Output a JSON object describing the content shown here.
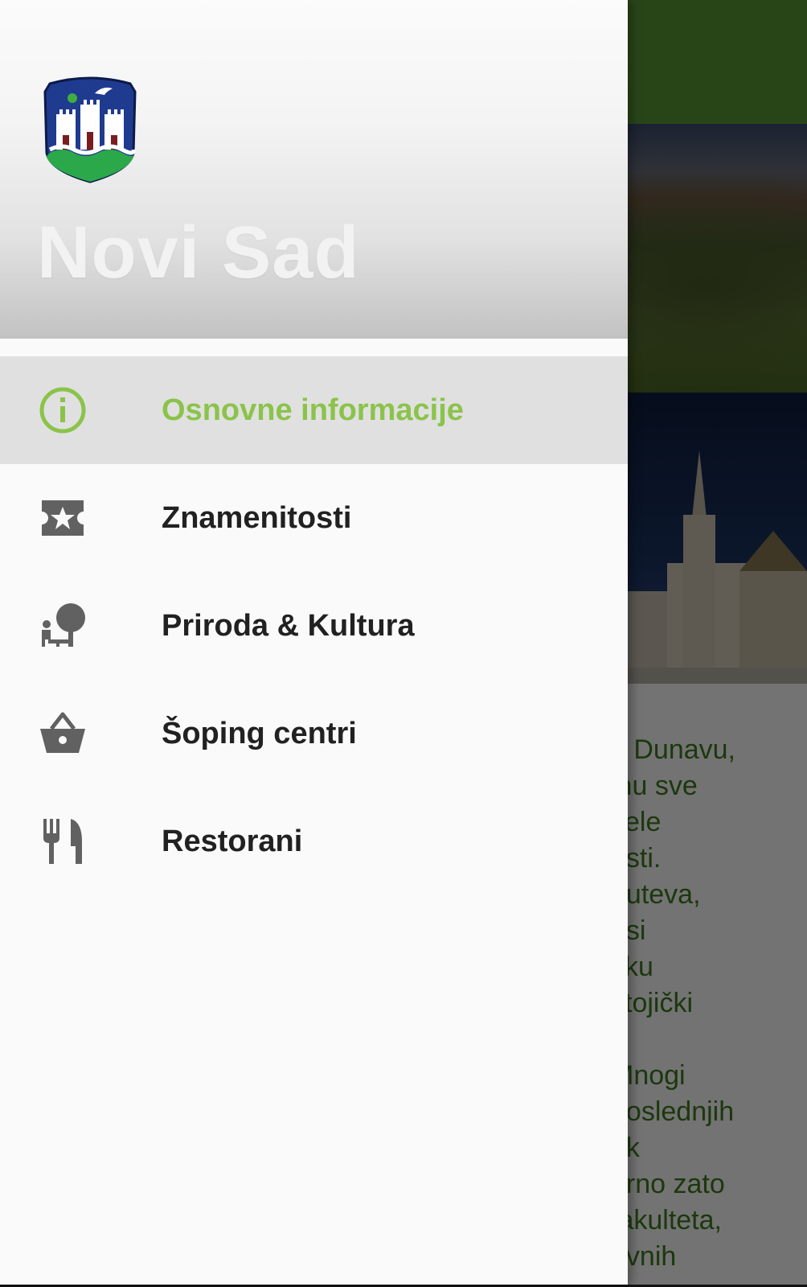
{
  "app_background": {
    "toolbar_color": "#5a9a36",
    "images": [
      "fortress-photo",
      "church-photo"
    ],
    "body_text_lines": [
      "a Dunavu,",
      "inu sve",
      "žele",
      "osti.",
      "puteva,",
      "osi",
      "itku",
      "stojički",
      "",
      "Mnogi",
      "poslednjih",
      "ak",
      "urno zato",
      "fakulteta,",
      "ovnih"
    ]
  },
  "drawer": {
    "header": {
      "crest_icon": "novi-sad-coat-of-arms",
      "title": "Novi Sad"
    },
    "menu": [
      {
        "label": "Osnovne informacije",
        "icon": "info-icon",
        "active": true
      },
      {
        "label": "Znamenitosti",
        "icon": "ticket-star-icon",
        "active": false
      },
      {
        "label": "Priroda & Kultura",
        "icon": "nature-people-icon",
        "active": false
      },
      {
        "label": "Šoping centri",
        "icon": "shopping-basket-icon",
        "active": false
      },
      {
        "label": "Restorani",
        "icon": "restaurant-icon",
        "active": false
      }
    ],
    "colors": {
      "active_accent": "#8bc34a",
      "active_background": "#e0e0e0",
      "icon_color": "#616161",
      "text_color": "#212121"
    }
  }
}
